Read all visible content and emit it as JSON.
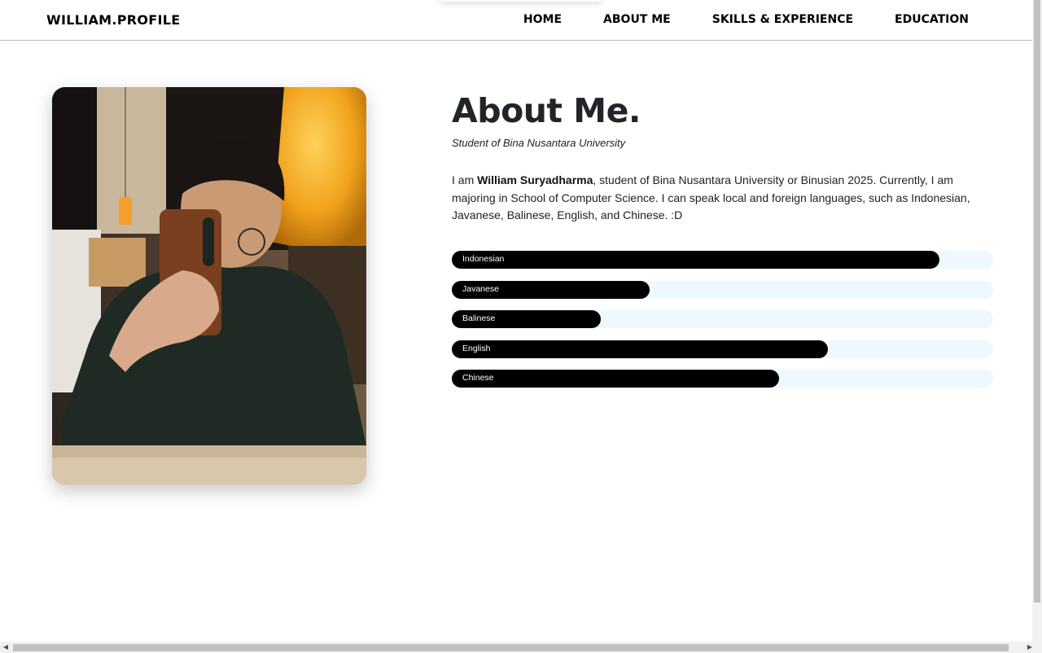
{
  "header": {
    "brand": "WILLIAM.PROFILE",
    "nav": [
      "HOME",
      "ABOUT ME",
      "SKILLS & EXPERIENCE",
      "EDUCATION"
    ]
  },
  "about": {
    "title": "About Me.",
    "subtitle": "Student of Bina Nusantara University",
    "bio_prefix": "I am ",
    "bio_name": "William Suryadharma",
    "bio_rest": ", student of Bina Nusantara University or Binusian 2025. Currently, I am majoring in School of Computer Science. I can speak local and foreign languages, such as Indonesian, Javanese, Balinese, English, and Chinese. :D"
  },
  "skills": [
    {
      "label": "Indonesian",
      "level": 90
    },
    {
      "label": "Javanese",
      "level": 36.5
    },
    {
      "label": "Balinese",
      "level": 27.5
    },
    {
      "label": "English",
      "level": 69.5
    },
    {
      "label": "Chinese",
      "level": 60.5
    }
  ],
  "colors": {
    "bar_fill": "#000000",
    "bar_track": "#eef8ff",
    "text": "#212529"
  },
  "scrollbars": {
    "up_icon": "arrow-up-icon",
    "down_icon": "arrow-down-icon",
    "left_icon": "arrow-left-icon",
    "right_icon": "arrow-right-icon"
  }
}
